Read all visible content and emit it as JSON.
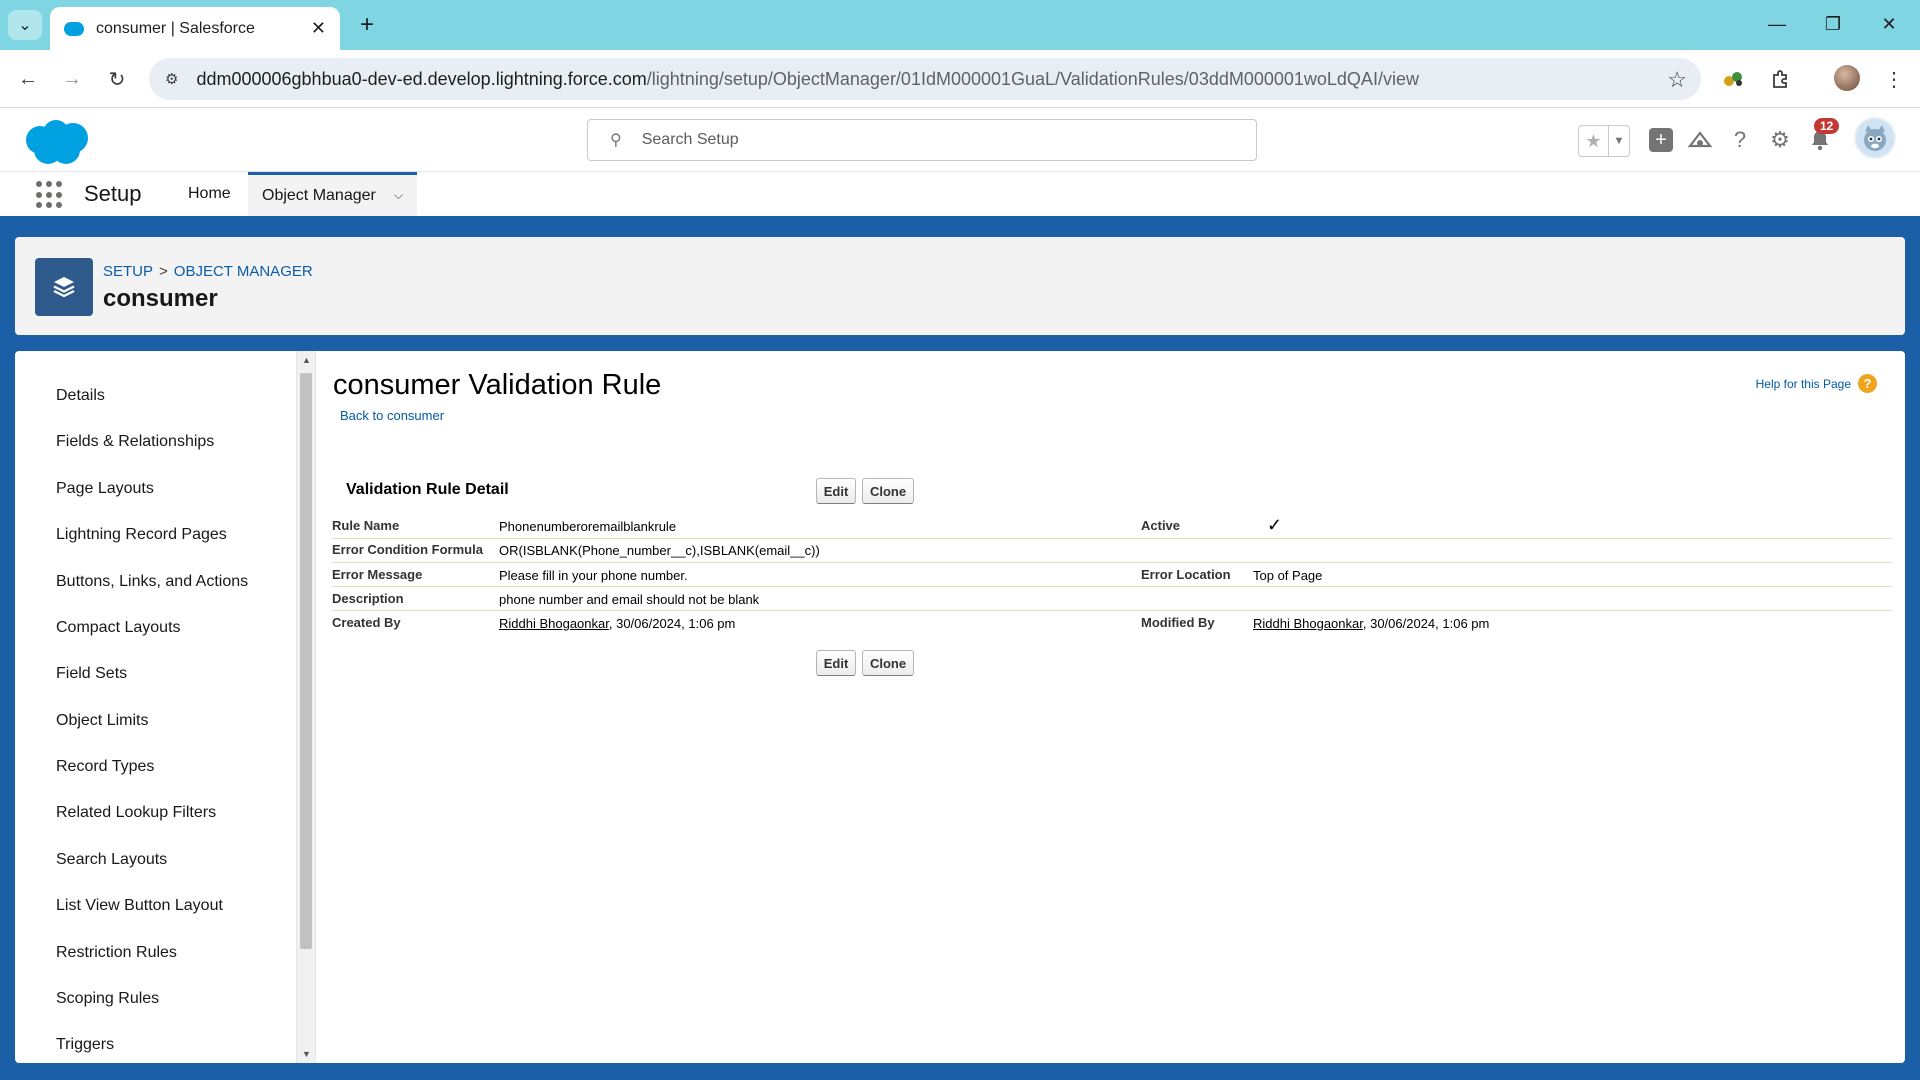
{
  "browser": {
    "tab_title": "consumer | Salesforce",
    "url_host": "ddm000006gbhbua0-dev-ed.develop.lightning.force.com",
    "url_path": "/lightning/setup/ObjectManager/01IdM000001GuaL/ValidationRules/03ddM000001woLdQAI/view"
  },
  "header": {
    "search_placeholder": "Search Setup",
    "notification_count": "12"
  },
  "nav": {
    "app_name": "Setup",
    "items": [
      {
        "label": "Home"
      },
      {
        "label": "Object Manager"
      }
    ]
  },
  "page_header": {
    "breadcrumb_setup": "SETUP",
    "breadcrumb_sep": ">",
    "breadcrumb_object_manager": "OBJECT MANAGER",
    "title": "consumer"
  },
  "sidebar": {
    "items": [
      {
        "label": "Details"
      },
      {
        "label": "Fields & Relationships"
      },
      {
        "label": "Page Layouts"
      },
      {
        "label": "Lightning Record Pages"
      },
      {
        "label": "Buttons, Links, and Actions"
      },
      {
        "label": "Compact Layouts"
      },
      {
        "label": "Field Sets"
      },
      {
        "label": "Object Limits"
      },
      {
        "label": "Record Types"
      },
      {
        "label": "Related Lookup Filters"
      },
      {
        "label": "Search Layouts"
      },
      {
        "label": "List View Button Layout"
      },
      {
        "label": "Restriction Rules"
      },
      {
        "label": "Scoping Rules"
      },
      {
        "label": "Triggers"
      }
    ]
  },
  "main": {
    "title": "consumer Validation Rule",
    "back_link": "Back to consumer",
    "help_link": "Help for this Page",
    "help_icon": "?",
    "section_title": "Validation Rule Detail",
    "edit_label": "Edit",
    "clone_label": "Clone",
    "fields": {
      "rule_name_label": "Rule Name",
      "rule_name": "Phonenumberoremailblankrule",
      "active_label": "Active",
      "active_mark": "✓",
      "formula_label": "Error Condition Formula",
      "formula": "OR(ISBLANK(Phone_number__c),ISBLANK(email__c))",
      "error_message_label": "Error Message",
      "error_message": "Please fill in your phone number.",
      "error_location_label": "Error Location",
      "error_location": "Top of Page",
      "description_label": "Description",
      "description": "phone number and email should not be blank",
      "created_by_label": "Created By",
      "created_by_user": "Riddhi Bhogaonkar",
      "created_by_date": ", 30/06/2024, 1:06 pm",
      "modified_by_label": "Modified By",
      "modified_by_user": "Riddhi Bhogaonkar",
      "modified_by_date": ", 30/06/2024, 1:06 pm"
    }
  },
  "colors": {
    "brand_blue": "#1b5fa7",
    "link_blue": "#015ba7",
    "tabstrip": "#7fd6e2",
    "badge_red": "#c23934"
  }
}
